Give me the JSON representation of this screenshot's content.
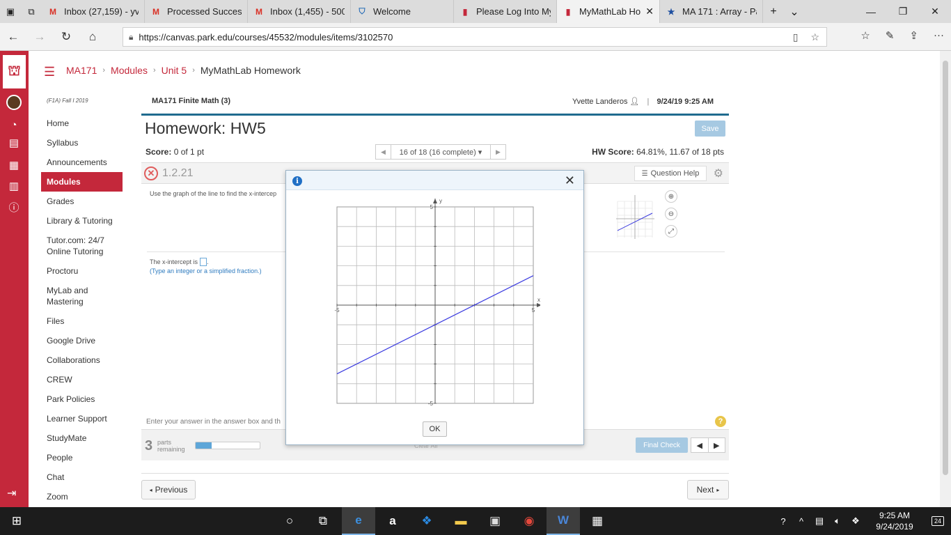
{
  "browser": {
    "tabs": [
      {
        "label": "Inbox (27,159) - yv",
        "icon": "gmail-icon",
        "active": false
      },
      {
        "label": "Processed Successf",
        "icon": "gmail-icon",
        "active": false
      },
      {
        "label": "Inbox (1,455) - 500",
        "icon": "gmail-icon",
        "active": false
      },
      {
        "label": "Welcome",
        "icon": "shield-icon",
        "active": false
      },
      {
        "label": "Please Log Into My",
        "icon": "pearson-icon",
        "active": false
      },
      {
        "label": "MyMathLab Ho",
        "icon": "pearson-icon",
        "active": true
      },
      {
        "label": "MA 171 : Array - Pa",
        "icon": "star-icon",
        "active": false
      }
    ],
    "url": "https://canvas.park.edu/courses/45532/modules/items/3102570"
  },
  "breadcrumbs": {
    "course": "MA171",
    "modules": "Modules",
    "unit": "Unit 5",
    "current": "MyMathLab Homework"
  },
  "course_nav": {
    "term": "(F1A) Fall I 2019",
    "items": [
      "Home",
      "Syllabus",
      "Announcements",
      "Modules",
      "Grades",
      "Library & Tutoring",
      "Tutor.com: 24/7 Online Tutoring",
      "Proctoru",
      "MyLab and Mastering",
      "Files",
      "Google Drive",
      "Collaborations",
      "CREW",
      "Park Policies",
      "Learner Support",
      "StudyMate",
      "People",
      "Chat",
      "Zoom"
    ],
    "active": "Modules"
  },
  "mml": {
    "course_title": "MA171 Finite Math (3)",
    "user": "Yvette Landeros",
    "datetime": "9/24/19 9:25 AM",
    "hw_title": "Homework: HW5",
    "save_label": "Save",
    "score_label": "Score:",
    "score_value": "0 of 1 pt",
    "qnav_text": "16 of 18 (16 complete)",
    "hw_score_label": "HW Score:",
    "hw_score_value": "64.81%, 11.67 of 18 pts",
    "question_number": "1.2.21",
    "question_help": "Question Help",
    "question_text": "Use the graph of the line to find the x-intercep",
    "xint_label": "The x-intercept is",
    "hint": "(Type an integer or a simplified fraction.)",
    "enter_text": "Enter your answer in the answer box and th",
    "parts_count": "3",
    "parts_label_1": "parts",
    "parts_label_2": "remaining",
    "parts_progress": 0.25,
    "clear_all": "Clear All",
    "final_check": "Final Check",
    "previous": "Previous",
    "next": "Next"
  },
  "modal": {
    "ok_label": "OK",
    "graph": {
      "x_range": [
        -5,
        5
      ],
      "y_range": [
        -5,
        5
      ],
      "line": {
        "x1": -5,
        "y1": -3.5,
        "x2": 5,
        "y2": 1.5
      },
      "line_color": "#3a3adf",
      "labels": {
        "x_axis": "x",
        "y_axis": "y",
        "xmin": "-5",
        "xmax": "5",
        "ymin": "-5",
        "ymax": "5"
      }
    }
  },
  "taskbar": {
    "time": "9:25 AM",
    "date": "9/24/2019",
    "notifications": "24"
  },
  "colors": {
    "canvas_red": "#c4283b",
    "mml_blue": "#1f6b8f"
  }
}
